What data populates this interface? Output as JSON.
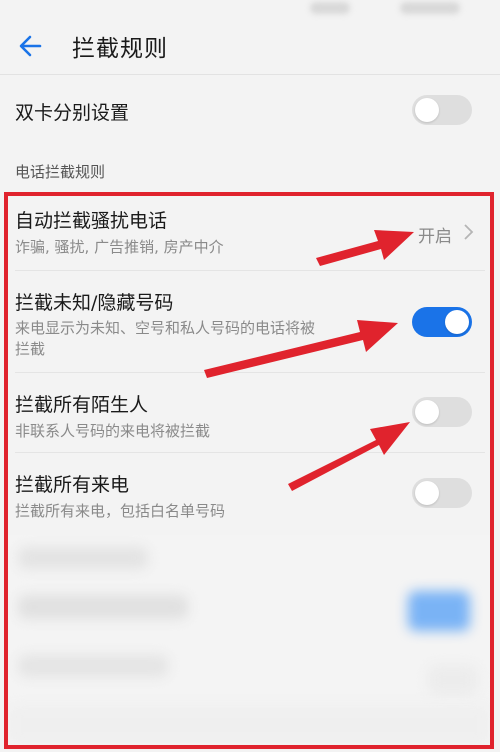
{
  "header": {
    "title": "拦截规则"
  },
  "dual_sim": {
    "label": "双卡分别设置",
    "enabled": false
  },
  "section": {
    "label": "电话拦截规则"
  },
  "rules": [
    {
      "title": "自动拦截骚扰电话",
      "subtitle": "诈骗, 骚扰, 广告推销, 房产中介",
      "status": "开启"
    },
    {
      "title": "拦截未知/隐藏号码",
      "subtitle_line1": "来电显示为未知、空号和私人号码的电话将被",
      "subtitle_line2": "拦截",
      "enabled": true
    },
    {
      "title": "拦截所有陌生人",
      "subtitle": "非联系人号码的来电将被拦截",
      "enabled": false
    },
    {
      "title": "拦截所有来电",
      "subtitle": "拦截所有来电，包括白名单号码",
      "enabled": false
    }
  ],
  "colors": {
    "accent": "#1a73e8",
    "annotation": "#e0232d",
    "background": "#f3f3f3"
  },
  "icons": {
    "back": "arrow-left-icon",
    "chevron": "chevron-right-icon"
  }
}
